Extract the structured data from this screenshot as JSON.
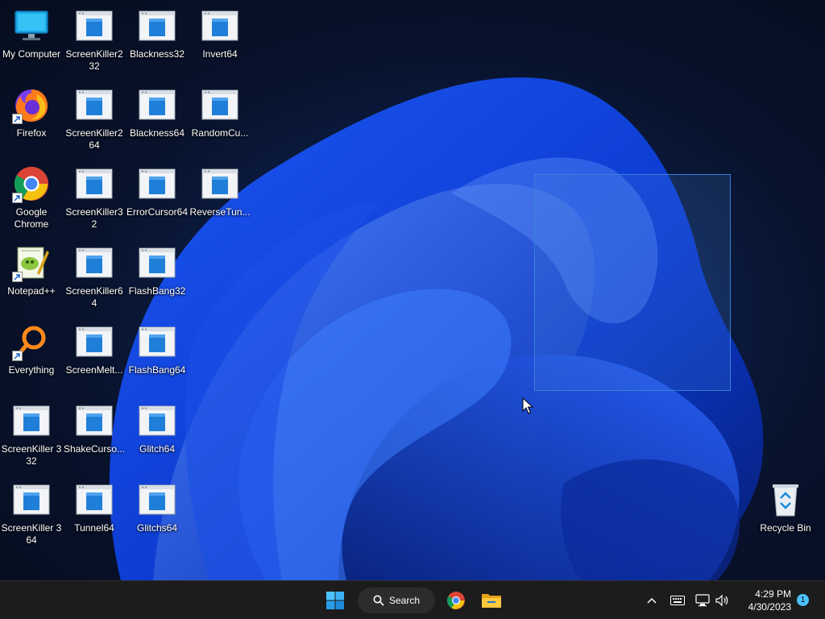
{
  "desktop": {
    "icons": [
      {
        "label": "My Computer",
        "kind": "computer-icon"
      },
      {
        "label": "ScreenKiller2 32",
        "kind": "app-window-icon"
      },
      {
        "label": "Blackness32",
        "kind": "app-window-icon"
      },
      {
        "label": "Invert64",
        "kind": "app-window-icon"
      },
      {
        "label": "Firefox",
        "kind": "firefox-icon",
        "shortcut": true
      },
      {
        "label": "ScreenKiller2 64",
        "kind": "app-window-icon"
      },
      {
        "label": "Blackness64",
        "kind": "app-window-icon"
      },
      {
        "label": "RandomCu...",
        "kind": "app-window-icon"
      },
      {
        "label": "Google Chrome",
        "kind": "chrome-icon",
        "shortcut": true
      },
      {
        "label": "ScreenKiller32",
        "kind": "app-window-icon"
      },
      {
        "label": "ErrorCursor64",
        "kind": "app-window-icon"
      },
      {
        "label": "ReverseTun...",
        "kind": "app-window-icon"
      },
      {
        "label": "Notepad++",
        "kind": "notepadpp-icon",
        "shortcut": true
      },
      {
        "label": "ScreenKiller64",
        "kind": "app-window-icon"
      },
      {
        "label": "FlashBang32",
        "kind": "app-window-icon"
      },
      {
        "label": "Everything",
        "kind": "everything-icon",
        "shortcut": true
      },
      {
        "label": "ScreenMelt...",
        "kind": "app-window-icon"
      },
      {
        "label": "FlashBang64",
        "kind": "app-window-icon"
      },
      {
        "label": "ScreenKiller 3 32",
        "kind": "app-window-icon"
      },
      {
        "label": "ShakeCurso...",
        "kind": "app-window-icon"
      },
      {
        "label": "Glitch64",
        "kind": "app-window-icon"
      },
      {
        "label": "ScreenKiller 3 64",
        "kind": "app-window-icon"
      },
      {
        "label": "Tunnel64",
        "kind": "app-window-icon"
      },
      {
        "label": "Glitchs64",
        "kind": "app-window-icon"
      },
      {
        "label": "Recycle Bin",
        "kind": "recycle-bin-icon"
      }
    ]
  },
  "taskbar": {
    "search_label": "Search",
    "pinned": [
      "start-icon",
      "search-icon",
      "chrome-icon",
      "file-explorer-icon"
    ],
    "tray": [
      "chevron-up-icon",
      "keyboard-icon",
      "network-icon",
      "volume-icon"
    ],
    "time": "4:29 PM",
    "date": "4/30/2023",
    "notification_count": "1"
  },
  "colors": {
    "accent": "#0078d4",
    "taskbar": "#1c1c1c",
    "selection": "#3b7fd6"
  }
}
